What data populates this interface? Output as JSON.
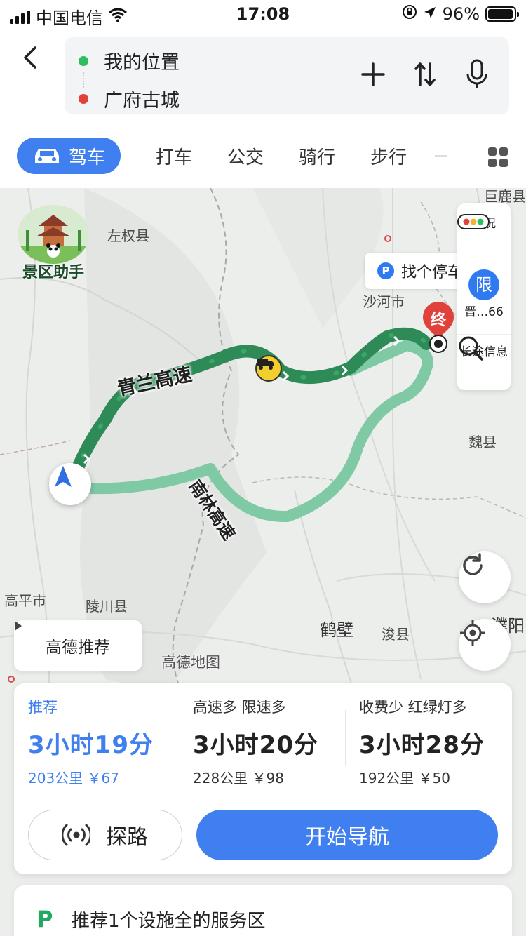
{
  "status_bar": {
    "carrier": "中国电信",
    "time": "17:08",
    "battery": "96%",
    "battery_level": 0.96
  },
  "header": {
    "origin": "我的位置",
    "destination": "广府古城",
    "origin_color": "#2dbe60",
    "destination_color": "#e0413a"
  },
  "tabs": {
    "active": "驾车",
    "items": [
      "打车",
      "公交",
      "骑行",
      "步行"
    ]
  },
  "map": {
    "badge_label": "景区助手",
    "parking_label": "找个停车",
    "tools": {
      "traffic": "路况",
      "limit_icon": "限",
      "limit_label": "晋…66",
      "longtrip": "长途信息"
    },
    "end_pin": "终",
    "road_labels": [
      "青兰高速",
      "南林高速"
    ],
    "place_labels": {
      "zuoquan": "左权县",
      "shahe": "沙河市",
      "weixian": "魏县",
      "gaoping": "高平市",
      "lingchuan": "陵川县",
      "hebi": "鹤壁",
      "xunxian": "浚县",
      "puyang": "濮阳",
      "julu": "巨鹿县"
    },
    "recommend_btn": "高德推荐",
    "watermark": "高德地图",
    "route_colors": {
      "main": "#2e8b57",
      "alt": "#7fc9a5"
    }
  },
  "routes": [
    {
      "tag": "推荐",
      "duration": "3小时19分",
      "distance": "203公里",
      "toll": "￥67"
    },
    {
      "tag": "高速多  限速多",
      "duration": "3小时20分",
      "distance": "228公里",
      "toll": "￥98"
    },
    {
      "tag": "收费少  红绿灯多",
      "duration": "3小时28分",
      "distance": "192公里",
      "toll": "￥50"
    }
  ],
  "actions": {
    "explore": "探路",
    "start_nav": "开始导航"
  },
  "service_banner": "推荐1个设施全的服务区"
}
